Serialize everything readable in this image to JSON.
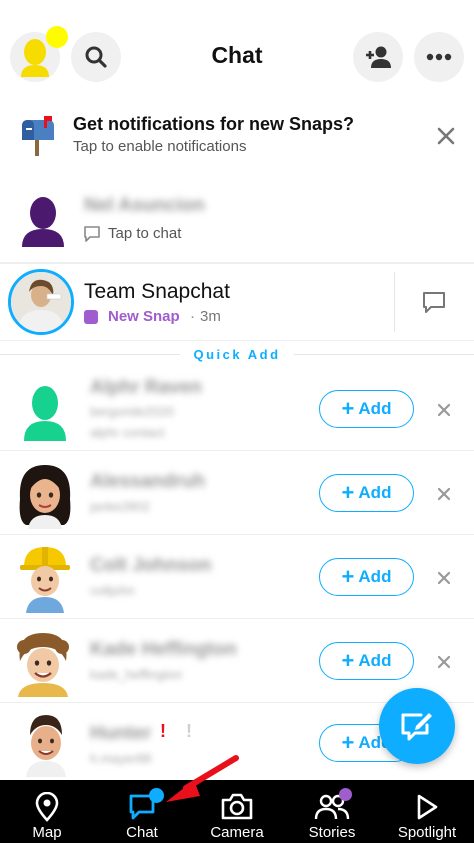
{
  "header": {
    "title": "Chat",
    "avatar_icon": "bitmoji-avatar-icon",
    "search_icon": "search-icon",
    "add_friend_icon": "add-friend-icon",
    "more_icon": "more-icon",
    "brand_yellow": "#fffc00"
  },
  "notification_banner": {
    "title": "Get notifications for new Snaps?",
    "subtitle": "Tap to enable notifications",
    "icon": "mailbox-icon"
  },
  "chats": [
    {
      "name": "Nel Asuncion",
      "status": "Tap to chat"
    },
    {
      "name": "Team Snapchat",
      "status": "New Snap",
      "time": "3m"
    }
  ],
  "quick_add": {
    "label": "Quick Add",
    "button_label": "Add",
    "items": [
      {
        "name": "Alphr Raven",
        "username": "bergoride2020",
        "detail": "alphr contact"
      },
      {
        "name": "Alessandruh",
        "username": "janke2802"
      },
      {
        "name": "Colt Johnson",
        "username": "coltjohn"
      },
      {
        "name": "Kade Heffington",
        "username": "kade_heffington"
      },
      {
        "name": "Hunter",
        "username": "h.mayer88"
      }
    ]
  },
  "navbar": {
    "items": [
      {
        "label": "Map"
      },
      {
        "label": "Chat"
      },
      {
        "label": "Camera"
      },
      {
        "label": "Stories"
      },
      {
        "label": "Spotlight"
      }
    ]
  },
  "colors": {
    "accent_blue": "#0fadff",
    "new_snap_purple": "#a05dcd",
    "annotation_red": "#e8111b"
  }
}
